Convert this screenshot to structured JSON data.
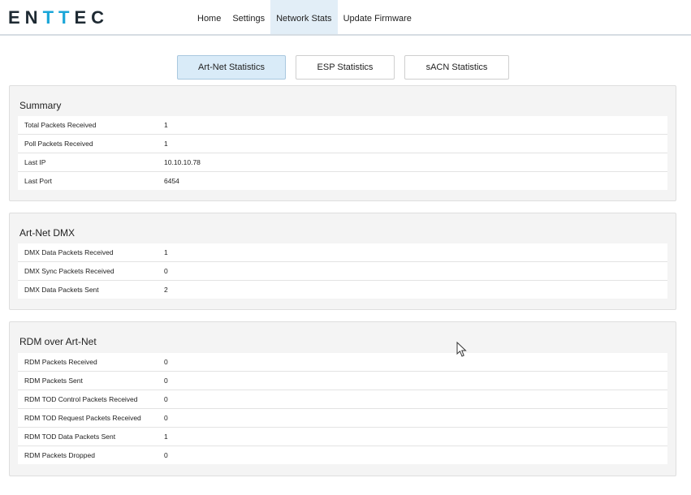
{
  "header": {
    "logo_left": "EN",
    "logo_accent": "TT",
    "logo_right": "EC",
    "nav": [
      "Home",
      "Settings",
      "Network Stats",
      "Update Firmware"
    ],
    "active_nav": "Network Stats"
  },
  "stat_tabs": [
    "Art-Net Statistics",
    "ESP Statistics",
    "sACN Statistics"
  ],
  "active_stat_tab": "Art-Net Statistics",
  "summary": {
    "title": "Summary",
    "rows": [
      {
        "label": "Total Packets Received",
        "value": "1"
      },
      {
        "label": "Poll Packets Received",
        "value": "1"
      },
      {
        "label": "Last IP",
        "value": "10.10.10.78"
      },
      {
        "label": "Last Port",
        "value": "6454"
      }
    ]
  },
  "artnet_dmx": {
    "title": "Art-Net DMX",
    "rows": [
      {
        "label": "DMX Data Packets Received",
        "value": "1"
      },
      {
        "label": "DMX Sync Packets Received",
        "value": "0"
      },
      {
        "label": "DMX Data Packets Sent",
        "value": "2"
      }
    ]
  },
  "rdm": {
    "title": "RDM over Art-Net",
    "rows": [
      {
        "label": "RDM Packets Received",
        "value": "0"
      },
      {
        "label": "RDM Packets Sent",
        "value": "0"
      },
      {
        "label": "RDM TOD Control Packets Received",
        "value": "0"
      },
      {
        "label": "RDM TOD Request Packets Received",
        "value": "0"
      },
      {
        "label": "RDM TOD Data Packets Sent",
        "value": "1"
      },
      {
        "label": "RDM Packets Dropped",
        "value": "0"
      }
    ]
  },
  "colors": {
    "accent": "#1aa6d8",
    "active_tab": "#d9ebf8",
    "panel_bg": "#f4f4f4"
  }
}
